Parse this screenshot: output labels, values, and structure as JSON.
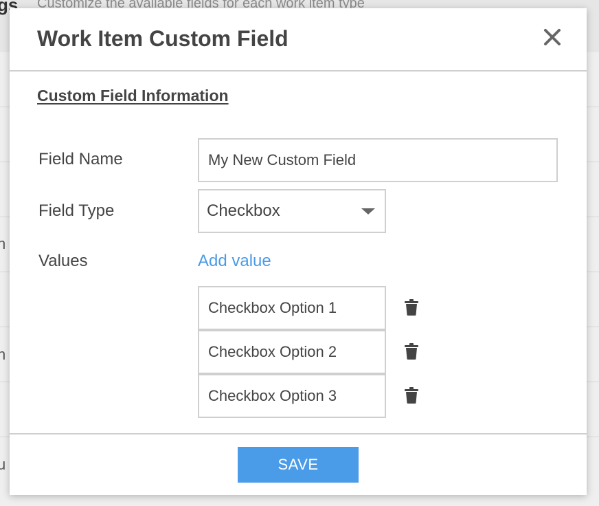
{
  "background": {
    "title_fragment": "gs",
    "subtitle": "Customize the available fields for each work item type",
    "row_fragments": [
      "n",
      "n",
      "u"
    ]
  },
  "modal": {
    "title": "Work Item Custom Field",
    "close_icon": "close-x-icon",
    "section_title": "Custom Field Information",
    "field_name": {
      "label": "Field Name",
      "value": "My New Custom Field"
    },
    "field_type": {
      "label": "Field Type",
      "selected": "Checkbox"
    },
    "values": {
      "label": "Values",
      "add_label": "Add value",
      "options": [
        "Checkbox Option 1",
        "Checkbox Option 2",
        "Checkbox Option 3"
      ],
      "delete_icon": "trash-icon"
    },
    "save_label": "SAVE"
  },
  "colors": {
    "accent": "#4a9be8",
    "text": "#444444",
    "border": "#cfcfcf"
  }
}
